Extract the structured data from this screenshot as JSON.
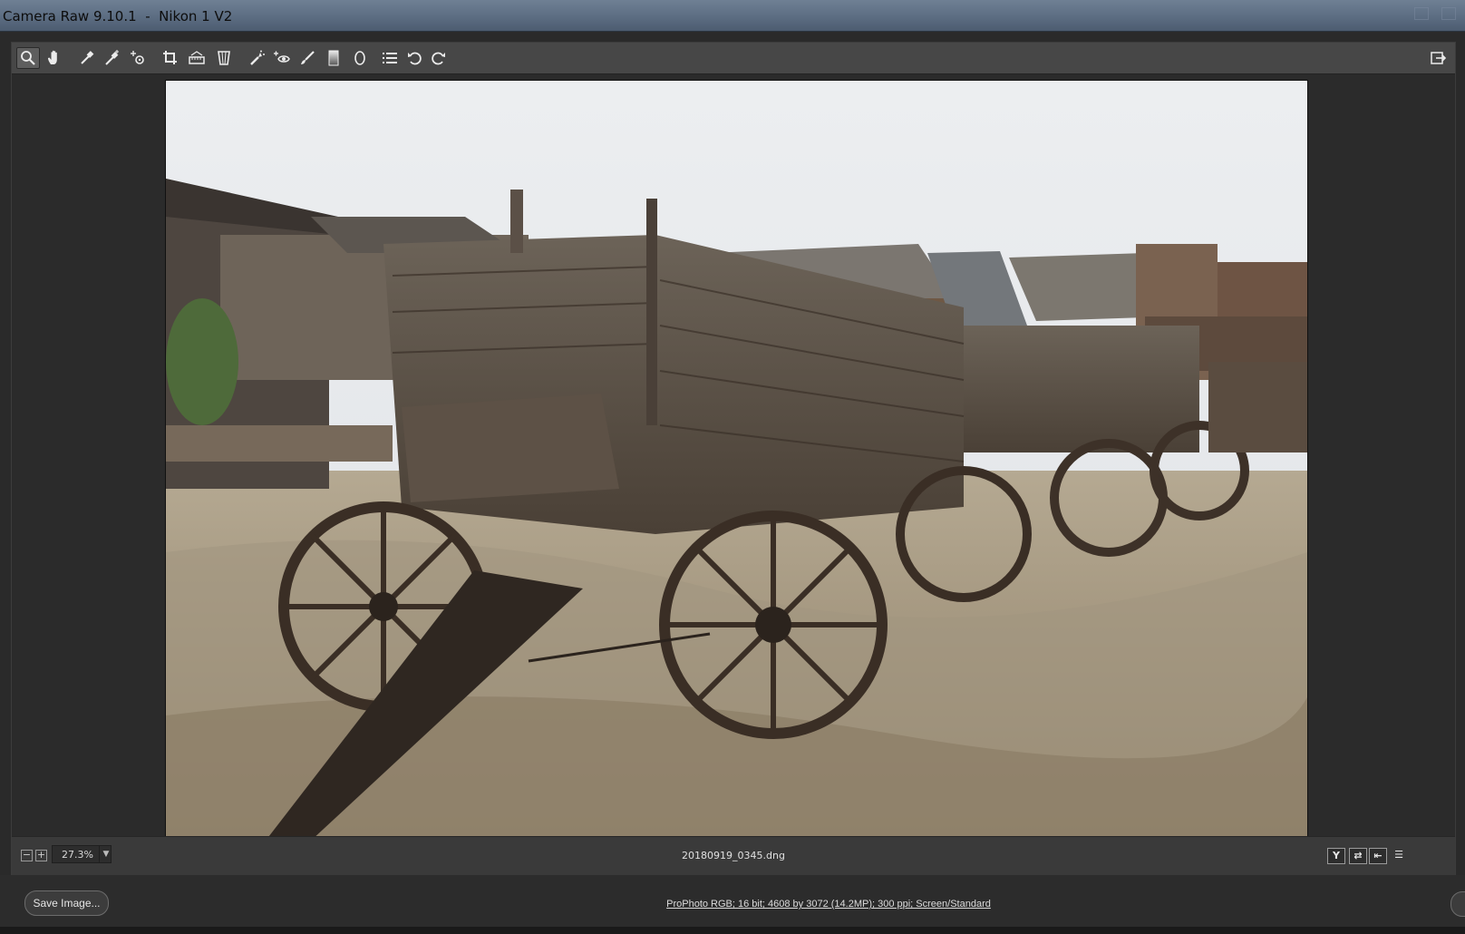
{
  "window": {
    "title": "Camera Raw 9.10.1  -  Nikon 1 V2"
  },
  "toolbar": {
    "tools": [
      {
        "name": "zoom-tool",
        "icon": "zoom-icon",
        "active": true
      },
      {
        "name": "hand-tool",
        "icon": "hand-icon"
      },
      {
        "name": "white-balance-tool",
        "icon": "eyedropper-icon"
      },
      {
        "name": "color-sampler-tool",
        "icon": "color-sampler-icon"
      },
      {
        "name": "targeted-adjustment-tool",
        "icon": "targeted-adjustment-icon"
      },
      {
        "name": "crop-tool",
        "icon": "crop-icon"
      },
      {
        "name": "straighten-tool",
        "icon": "straighten-icon"
      },
      {
        "name": "transform-tool",
        "icon": "transform-icon"
      },
      {
        "name": "spot-removal-tool",
        "icon": "spot-removal-icon"
      },
      {
        "name": "red-eye-removal-tool",
        "icon": "red-eye-icon"
      },
      {
        "name": "adjustment-brush-tool",
        "icon": "brush-icon"
      },
      {
        "name": "graduated-filter-tool",
        "icon": "graduated-filter-icon"
      },
      {
        "name": "radial-filter-tool",
        "icon": "radial-filter-icon"
      },
      {
        "name": "preferences-button",
        "icon": "list-icon"
      },
      {
        "name": "rotate-ccw-button",
        "icon": "rotate-ccw-icon"
      },
      {
        "name": "rotate-cw-button",
        "icon": "rotate-cw-icon"
      }
    ],
    "fullscreen_icon": "fullscreen-toggle-icon"
  },
  "preview": {
    "photo_subject": "old wooden wagons"
  },
  "status": {
    "zoom_out_symbol": "−",
    "zoom_in_symbol": "+",
    "zoom_level": "27.3%",
    "filename": "20180919_0345.dng",
    "view_buttons": [
      {
        "name": "before-after-button",
        "label": "Y"
      },
      {
        "name": "swap-settings-button",
        "label": "⇄"
      },
      {
        "name": "copy-settings-button",
        "label": "⇤"
      },
      {
        "name": "toggle-defaults-button",
        "label": "☰"
      }
    ]
  },
  "bottom": {
    "save_label": "Save Image...",
    "workflow_options": "ProPhoto RGB; 16 bit; 4608 by 3072 (14.2MP); 300 ppi; Screen/Standard"
  }
}
